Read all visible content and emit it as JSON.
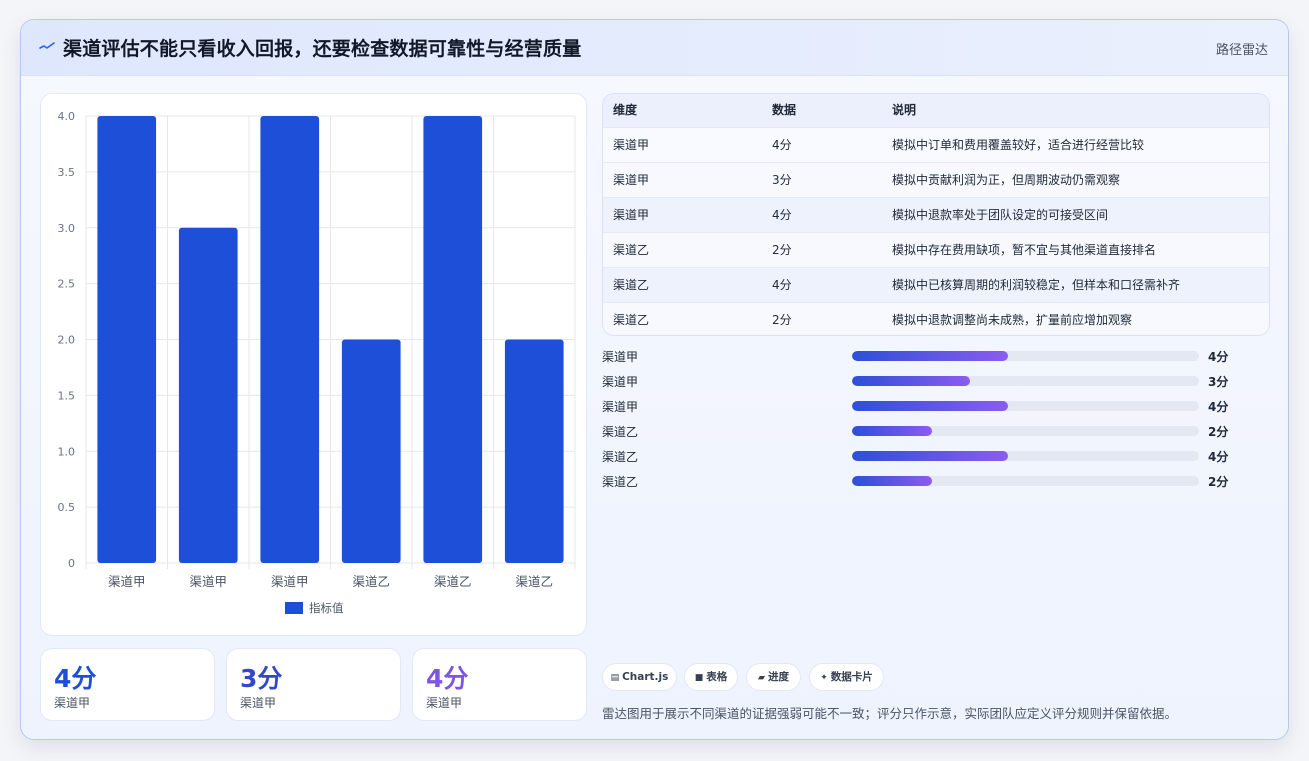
{
  "header": {
    "title": "渠道评估不能只看收入回报，还要检查数据可靠性与经营质量",
    "badge": "路径雷达"
  },
  "chart_data": {
    "type": "bar",
    "categories": [
      "渠道甲",
      "渠道甲",
      "渠道甲",
      "渠道乙",
      "渠道乙",
      "渠道乙"
    ],
    "series": [
      {
        "name": "指标值",
        "values": [
          4,
          3,
          4,
          2,
          4,
          2
        ]
      }
    ],
    "ylim": [
      0,
      4
    ],
    "yticks": [
      "0",
      "0.5",
      "1.0",
      "1.5",
      "2.0",
      "2.5",
      "3.0",
      "3.5",
      "4.0"
    ],
    "legend_position": "bottom",
    "grid": true,
    "bar_color": "#1d4fd8"
  },
  "stats": [
    {
      "value": "4分",
      "label": "渠道甲",
      "color": "#1d4ed8"
    },
    {
      "value": "3分",
      "label": "渠道甲",
      "color": "#3446c9"
    },
    {
      "value": "4分",
      "label": "渠道甲",
      "color": "#7c55e6"
    }
  ],
  "table": {
    "headers": [
      "维度",
      "数据",
      "说明"
    ],
    "rows": [
      [
        "渠道甲",
        "4分",
        "模拟中订单和费用覆盖较好，适合进行经营比较"
      ],
      [
        "渠道甲",
        "3分",
        "模拟中贡献利润为正，但周期波动仍需观察"
      ],
      [
        "渠道甲",
        "4分",
        "模拟中退款率处于团队设定的可接受区间"
      ],
      [
        "渠道乙",
        "2分",
        "模拟中存在费用缺项，暂不宜与其他渠道直接排名"
      ],
      [
        "渠道乙",
        "4分",
        "模拟中已核算周期的利润较稳定，但样本和口径需补齐"
      ],
      [
        "渠道乙",
        "2分",
        "模拟中退款调整尚未成熟，扩量前应增加观察"
      ]
    ]
  },
  "progress": [
    {
      "label": "渠道甲",
      "value_text": "4分",
      "fraction": 0.45
    },
    {
      "label": "渠道甲",
      "value_text": "3分",
      "fraction": 0.34
    },
    {
      "label": "渠道甲",
      "value_text": "4分",
      "fraction": 0.45
    },
    {
      "label": "渠道乙",
      "value_text": "2分",
      "fraction": 0.23
    },
    {
      "label": "渠道乙",
      "value_text": "4分",
      "fraction": 0.45
    },
    {
      "label": "渠道乙",
      "value_text": "2分",
      "fraction": 0.23
    }
  ],
  "chips": [
    {
      "icon": "▤",
      "label": "Chart.js"
    },
    {
      "icon": "■",
      "label": "表格"
    },
    {
      "icon": "▰",
      "label": "进度"
    },
    {
      "icon": "✦",
      "label": "数据卡片"
    }
  ],
  "note": "雷达图用于展示不同渠道的证据强弱可能不一致；评分只作示意，实际团队应定义评分规则并保留依据。"
}
